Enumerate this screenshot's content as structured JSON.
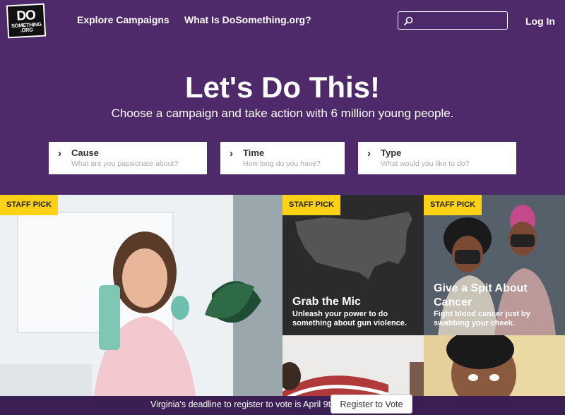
{
  "logo": {
    "line1": "DO",
    "line2": "SOMETHING",
    "line3": ".ORG"
  },
  "nav": {
    "explore": "Explore Campaigns",
    "what": "What Is DoSomething.org?",
    "login": "Log In"
  },
  "search": {
    "placeholder": ""
  },
  "hero": {
    "title": "Let's Do This!",
    "subtitle": "Choose a campaign and take action with 6 million young people."
  },
  "filters": [
    {
      "title": "Cause",
      "desc": "What are you passionate about?"
    },
    {
      "title": "Time",
      "desc": "How long do you have?"
    },
    {
      "title": "Type",
      "desc": "What would you like to do?"
    }
  ],
  "tiles": {
    "main": {
      "badge": "STAFF PICK"
    },
    "mic": {
      "badge": "STAFF PICK",
      "title": "Grab the Mic",
      "desc": "Unleash your power to do something about gun violence."
    },
    "spit": {
      "badge": "STAFF PICK",
      "title": "Give a Spit About Cancer",
      "desc": "Fight blood cancer just by swabbing your cheek."
    }
  },
  "footer": {
    "text": "Virginia's deadline to register to vote is April 9th.",
    "button": "Register to Vote"
  },
  "colors": {
    "brand_purple": "#4e2a6a",
    "badge_yellow": "#fcd116"
  }
}
